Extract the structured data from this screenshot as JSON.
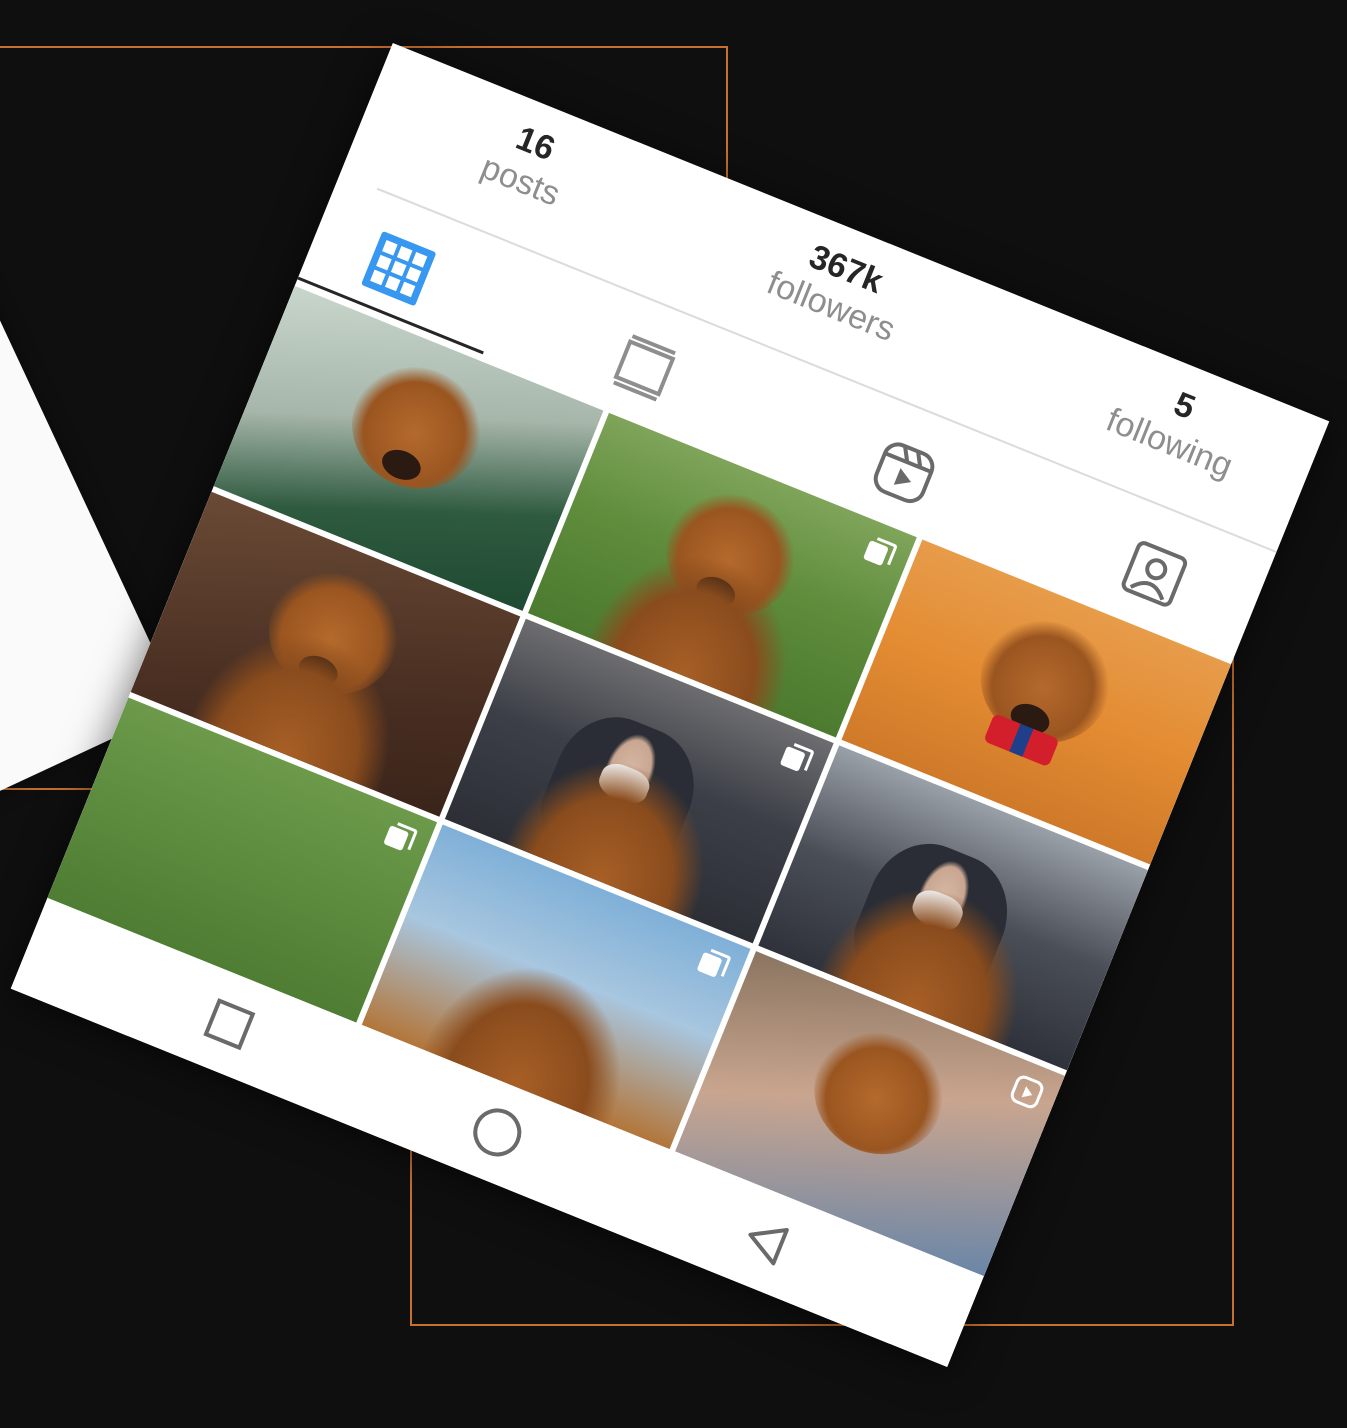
{
  "profile": {
    "stats": {
      "posts": {
        "count": "16",
        "label": "posts"
      },
      "followers": {
        "count": "367k",
        "label": "followers"
      },
      "following": {
        "count": "5",
        "label": "following"
      }
    }
  },
  "tabs": [
    {
      "icon": "grid-icon",
      "active": true
    },
    {
      "icon": "feed-icon",
      "active": false
    },
    {
      "icon": "reels-icon",
      "active": false
    },
    {
      "icon": "tagged-icon",
      "active": false
    }
  ],
  "colors": {
    "accent": "#3897f0",
    "frame": "#c8702f",
    "background": "#0f0f0f"
  },
  "navigation": {
    "buttons": [
      {
        "icon": "recents-square-icon"
      },
      {
        "icon": "home-circle-icon"
      },
      {
        "icon": "back-triangle-icon"
      }
    ]
  }
}
